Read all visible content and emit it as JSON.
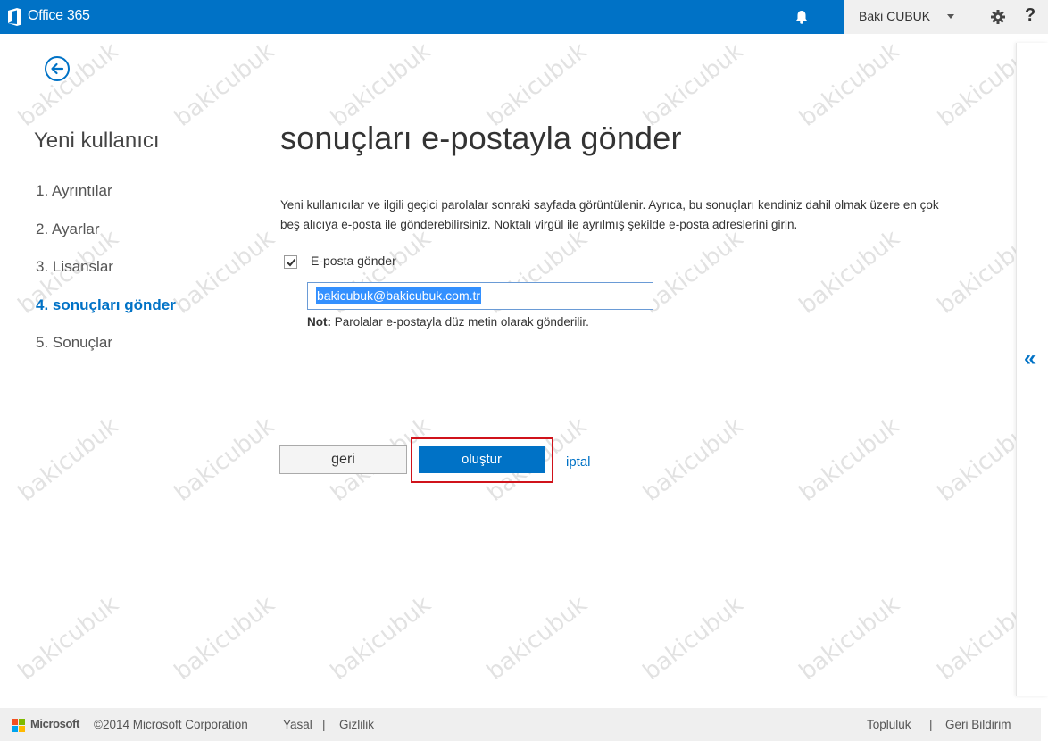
{
  "topbar": {
    "app_name": "Office 365",
    "user_name": "Baki CUBUK",
    "help_label": "?"
  },
  "wizard": {
    "title": "Yeni kullanıcı",
    "steps": [
      {
        "label": "1.  Ayrıntılar",
        "active": false
      },
      {
        "label": "2.  Ayarlar",
        "active": false
      },
      {
        "label": "3.  Lisanslar",
        "active": false
      },
      {
        "label": "4.  sonuçları gönder",
        "active": true
      },
      {
        "label": "5.  Sonuçlar",
        "active": false
      }
    ]
  },
  "main": {
    "title": "sonuçları e-postayla gönder",
    "description": "Yeni kullanıcılar ve ilgili geçici parolalar sonraki sayfada görüntülenir. Ayrıca, bu sonuçları kendiniz dahil olmak üzere en çok beş alıcıya e-posta ile gönderebilirsiniz. Noktalı virgül ile ayrılmış şekilde e-posta adreslerini girin.",
    "send_email_label": "E-posta gönder",
    "send_email_checked": true,
    "email_value": "bakicubuk@bakicubuk.com.tr",
    "note_bold": "Not:",
    "note_text": " Parolalar e-postayla düz metin olarak gönderilir."
  },
  "buttons": {
    "back_label": "geri",
    "create_label": "oluştur",
    "cancel_label": "iptal"
  },
  "collapse_icon": "«",
  "footer": {
    "brand": "Microsoft",
    "copyright": "©2014 Microsoft Corporation",
    "legal": "Yasal",
    "privacy": "Gizlilik",
    "community": "Topluluk",
    "feedback": "Geri Bildirim",
    "separator": "|"
  },
  "watermark": "bakicubuk",
  "colors": {
    "brand_blue": "#0072c6",
    "highlight_red": "#d0131b"
  }
}
